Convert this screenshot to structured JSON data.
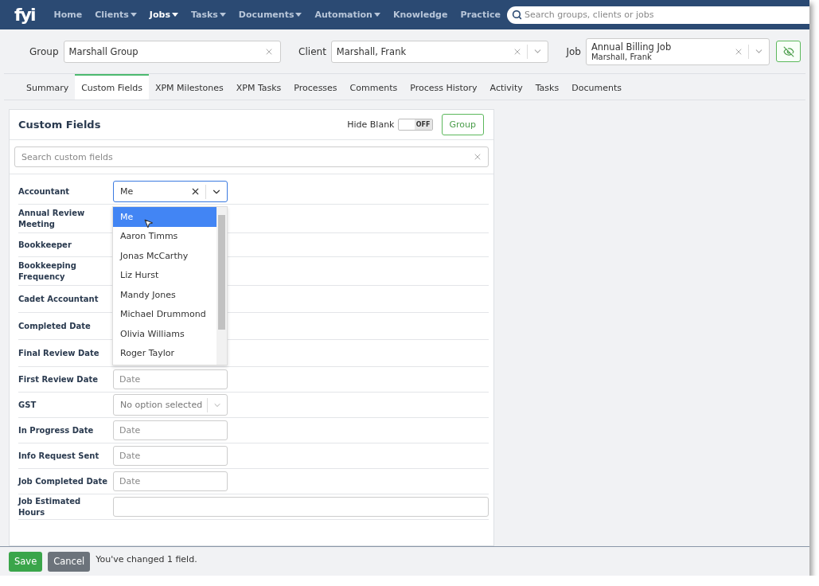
{
  "nav": {
    "logo": "fyi",
    "items": [
      {
        "label": "Home",
        "caret": false,
        "selected": false
      },
      {
        "label": "Clients",
        "caret": true,
        "selected": false
      },
      {
        "label": "Jobs",
        "caret": true,
        "selected": true
      },
      {
        "label": "Tasks",
        "caret": true,
        "selected": false
      },
      {
        "label": "Documents",
        "caret": true,
        "selected": false
      },
      {
        "label": "Automation",
        "caret": true,
        "selected": false
      },
      {
        "label": "Knowledge",
        "caret": false,
        "selected": false
      },
      {
        "label": "Practice",
        "caret": false,
        "selected": false
      }
    ],
    "search": {
      "placeholder": "Search groups, clients or jobs"
    }
  },
  "context": {
    "group": {
      "label": "Group",
      "value": "Marshall Group"
    },
    "client": {
      "label": "Client",
      "value": "Marshall, Frank"
    },
    "job": {
      "label": "Job",
      "value": "Annual Billing Job",
      "sub": "Marshall, Frank"
    }
  },
  "tabs": [
    {
      "label": "Summary",
      "selected": false
    },
    {
      "label": "Custom Fields",
      "selected": true
    },
    {
      "label": "XPM Milestones",
      "selected": false
    },
    {
      "label": "XPM Tasks",
      "selected": false
    },
    {
      "label": "Processes",
      "selected": false
    },
    {
      "label": "Comments",
      "selected": false
    },
    {
      "label": "Process History",
      "selected": false
    },
    {
      "label": "Activity",
      "selected": false
    },
    {
      "label": "Tasks",
      "selected": false
    },
    {
      "label": "Documents",
      "selected": false
    }
  ],
  "panel": {
    "title": "Custom Fields",
    "hide_blank": {
      "label": "Hide Blank",
      "on": false,
      "state_text": "OFF"
    },
    "group_button": "Group",
    "search": {
      "placeholder": "Search custom fields"
    },
    "fields": [
      {
        "label": "Accountant",
        "kind": "select",
        "value": "Me",
        "focused": true
      },
      {
        "label": "Annual Review Meeting",
        "kind": "covered"
      },
      {
        "label": "Bookkeeper",
        "kind": "covered"
      },
      {
        "label": "Bookkeeping Frequency",
        "kind": "covered"
      },
      {
        "label": "Cadet Accountant",
        "kind": "covered"
      },
      {
        "label": "Completed Date",
        "kind": "covered"
      },
      {
        "label": "Final Review Date",
        "kind": "covered"
      },
      {
        "label": "First Review Date",
        "kind": "date",
        "placeholder": "Date"
      },
      {
        "label": "GST",
        "kind": "select",
        "placeholder": "No option selected",
        "focused": false
      },
      {
        "label": "In Progress Date",
        "kind": "date",
        "placeholder": "Date"
      },
      {
        "label": "Info Request Sent",
        "kind": "date",
        "placeholder": "Date"
      },
      {
        "label": "Job Completed Date",
        "kind": "date",
        "placeholder": "Date"
      },
      {
        "label": "Job Estimated Hours",
        "kind": "text"
      }
    ],
    "dropdown": [
      {
        "label": "Me",
        "selected": true
      },
      {
        "label": "Aaron Timms",
        "selected": false
      },
      {
        "label": "Jonas McCarthy",
        "selected": false
      },
      {
        "label": "Liz Hurst",
        "selected": false
      },
      {
        "label": "Mandy Jones",
        "selected": false
      },
      {
        "label": "Michael Drummond",
        "selected": false
      },
      {
        "label": "Olivia Williams",
        "selected": false
      },
      {
        "label": "Roger Taylor",
        "selected": false
      }
    ]
  },
  "footer": {
    "save": "Save",
    "cancel": "Cancel",
    "message": "You've changed 1 field."
  }
}
